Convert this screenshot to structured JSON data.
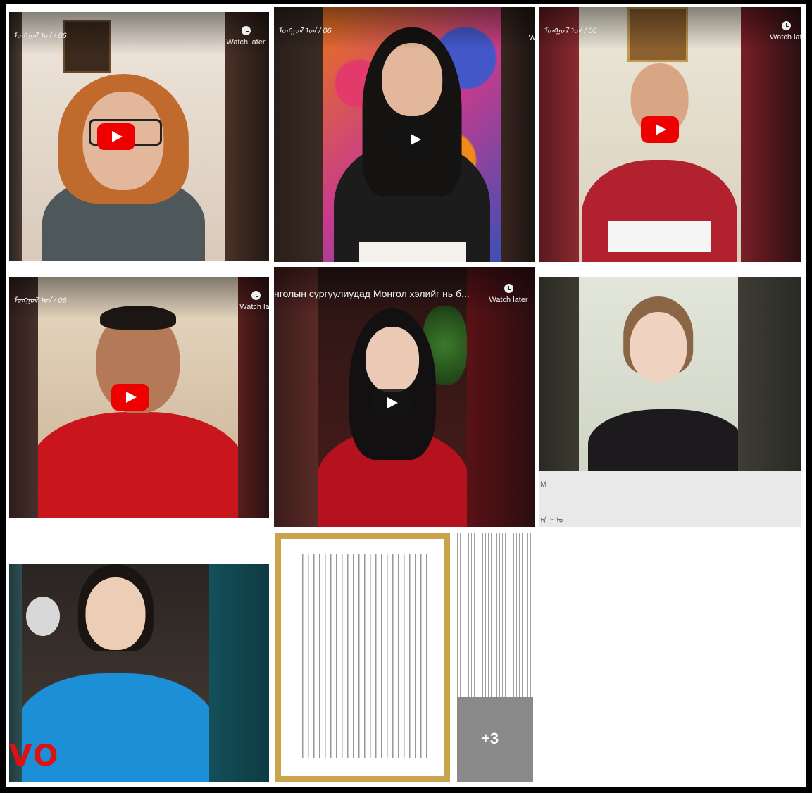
{
  "tiles": [
    {
      "id": "t1",
      "title": "ᠮᠣᠩᠭᠣᠯ ᠤᠨ / 06",
      "watch_later": "Watch later"
    },
    {
      "id": "t2",
      "title": "ᠮᠣᠩᠭᠣᠯ ᠤᠨ / 06",
      "watch_later": "W"
    },
    {
      "id": "t3",
      "title": "ᠮᠣᠩᠭᠣᠯ ᠤᠨ / 06",
      "watch_later": "Watch lat"
    },
    {
      "id": "t4",
      "title": "ᠮᠣᠩᠭᠣᠯ ᠤᠨ / 06",
      "watch_later": "Watch lat"
    },
    {
      "id": "t5",
      "title": "нголын сургуулиудад Монгол хэлийг нь б...",
      "watch_later": "Watch later"
    },
    {
      "id": "t6",
      "caption_top": "M",
      "caption_bottom": "ᠠ ᠨ ᠤ"
    },
    {
      "id": "t7",
      "overlay": "VO"
    },
    {
      "id": "t8",
      "more_count": "+3"
    }
  ],
  "colors": {
    "youtube_red": "#ee0000",
    "background": "#000000",
    "frame": "#ffffff"
  }
}
